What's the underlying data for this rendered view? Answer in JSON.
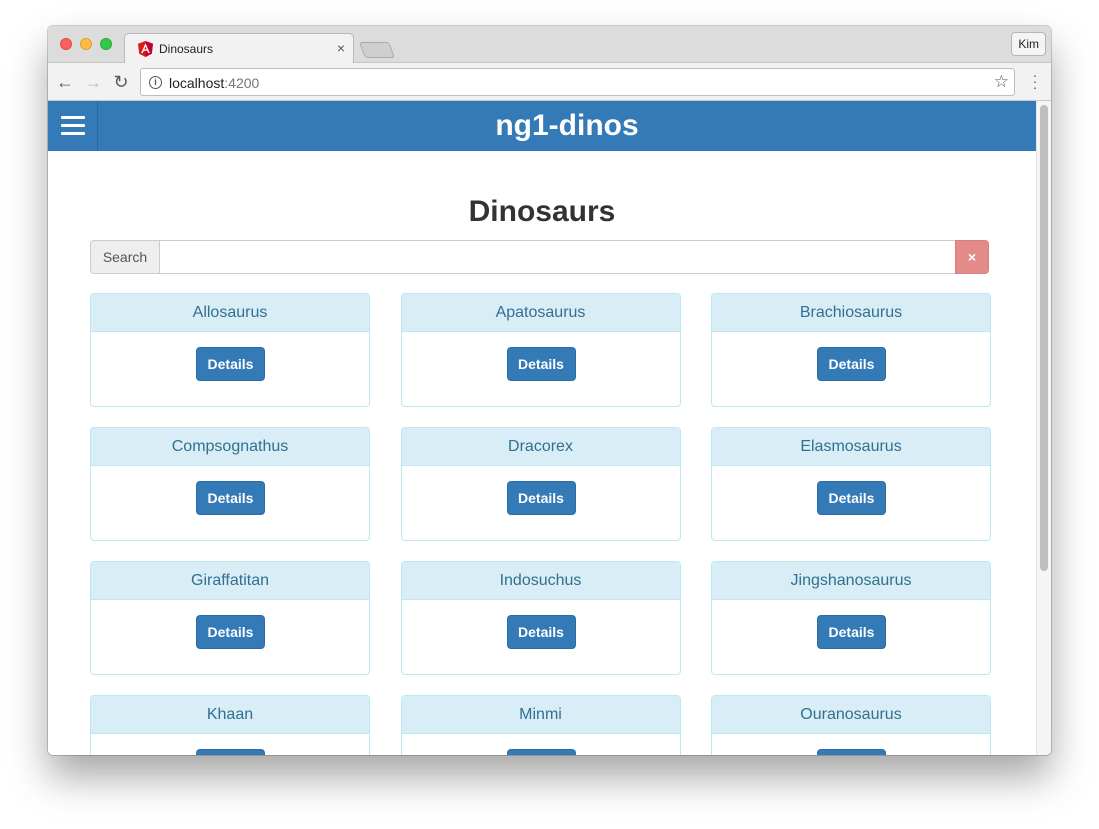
{
  "browser": {
    "tab_title": "Dinosaurs",
    "tab_close": "×",
    "profile": "Kim",
    "url_host": "localhost",
    "url_port": ":4200"
  },
  "app": {
    "brand": "ng1-dinos",
    "page_title": "Dinosaurs"
  },
  "search": {
    "label": "Search",
    "value": "",
    "placeholder": "",
    "clear_label": "×"
  },
  "dinos": [
    {
      "name": "Allosaurus",
      "button": "Details"
    },
    {
      "name": "Apatosaurus",
      "button": "Details"
    },
    {
      "name": "Brachiosaurus",
      "button": "Details"
    },
    {
      "name": "Compsognathus",
      "button": "Details"
    },
    {
      "name": "Dracorex",
      "button": "Details"
    },
    {
      "name": "Elasmosaurus",
      "button": "Details"
    },
    {
      "name": "Giraffatitan",
      "button": "Details"
    },
    {
      "name": "Indosuchus",
      "button": "Details"
    },
    {
      "name": "Jingshanosaurus",
      "button": "Details"
    },
    {
      "name": "Khaan",
      "button": "Details"
    },
    {
      "name": "Minmi",
      "button": "Details"
    },
    {
      "name": "Ouranosaurus",
      "button": "Details"
    }
  ],
  "colors": {
    "navbar": "#337ab7",
    "card_header": "#d9edf7",
    "card_title": "#31708f",
    "clear_button": "#e48b8a"
  }
}
